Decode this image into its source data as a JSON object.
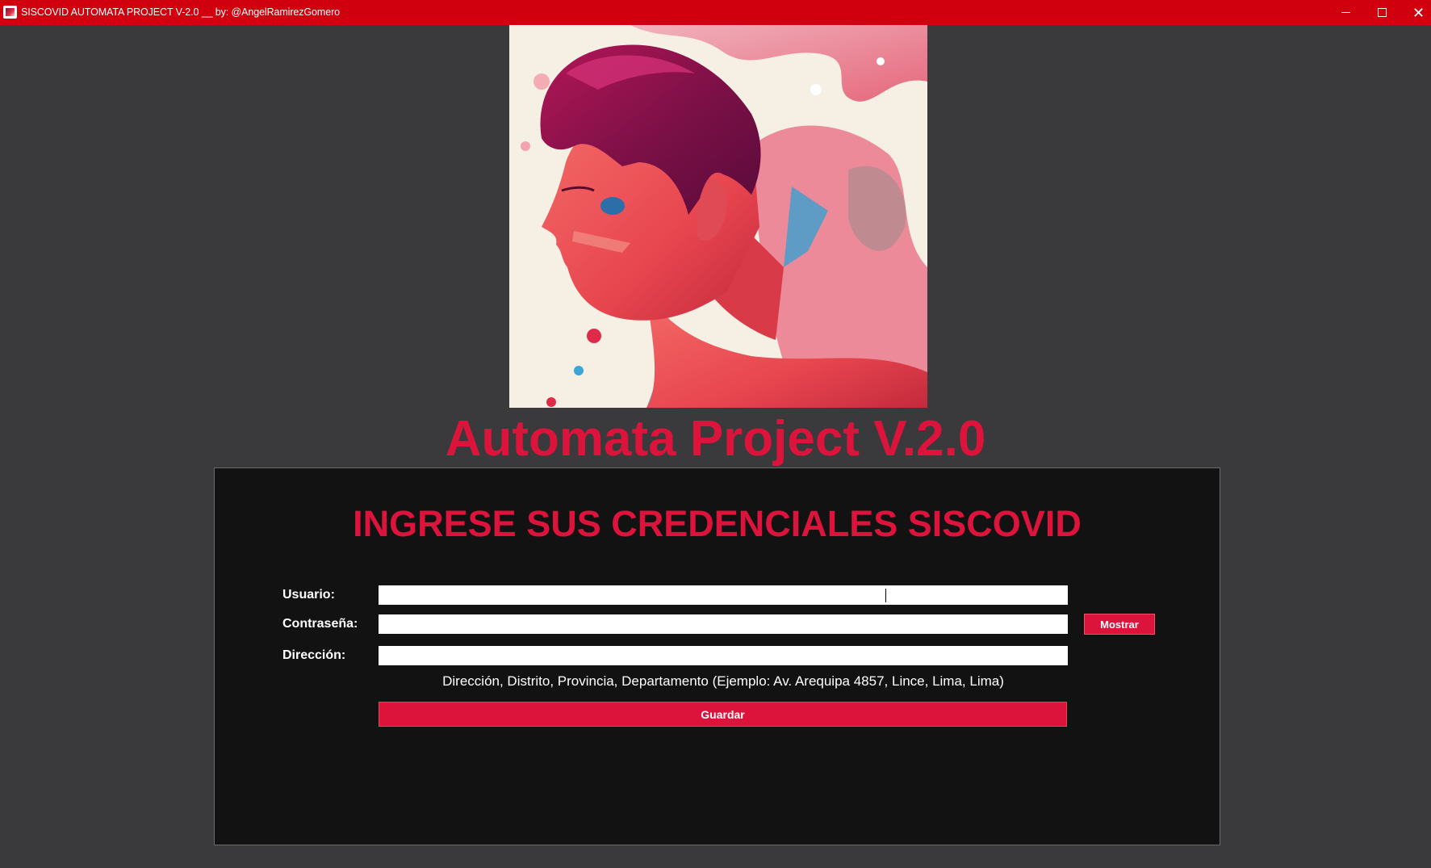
{
  "window": {
    "title": "SISCOVID AUTOMATA PROJECT V-2.0 __ by: @AngelRamirezGomero",
    "icon": "app-icon",
    "controls": [
      "minimize-icon",
      "maximize-icon",
      "close-icon"
    ],
    "close_glyph": "✕"
  },
  "hero": {
    "image": "illustrated-man-profile-portrait"
  },
  "app_title": "Automata Project V.2.0",
  "form": {
    "heading": "INGRESE SUS CREDENCIALES SISCOVID",
    "usuario_label": "Usuario:",
    "usuario_value": "",
    "contrasena_label": "Contraseña:",
    "contrasena_value": "",
    "direccion_label": "Dirección:",
    "direccion_value": "",
    "show_button": "Mostrar",
    "hint": "Dirección, Distrito, Provincia, Departamento (Ejemplo: Av. Arequipa 4857, Lince, Lima, Lima)",
    "save_button": "Guardar"
  },
  "colors": {
    "titlebar": "#d0000f",
    "accent": "#dc143c",
    "background": "#3a393c",
    "panel": "#121212"
  }
}
